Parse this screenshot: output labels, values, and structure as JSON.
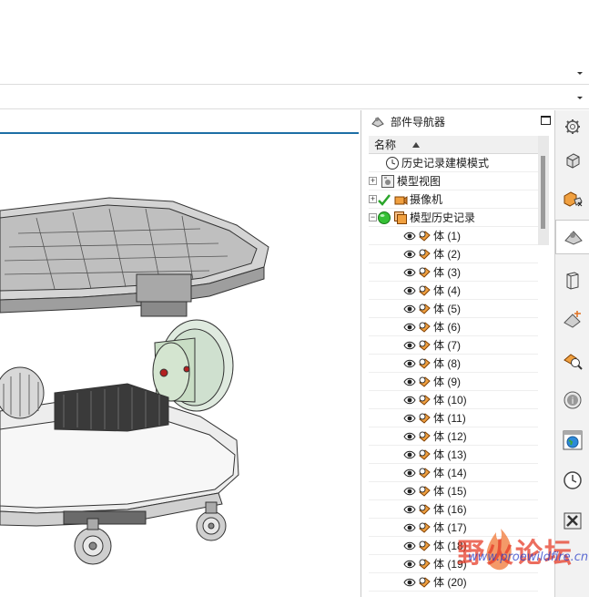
{
  "part_navigator": {
    "title": "部件导航器",
    "column_name": "名称",
    "items": [
      {
        "label": "历史记录建模模式",
        "type": "clock",
        "expand": ""
      },
      {
        "label": "模型视图",
        "type": "views",
        "expand": "+"
      },
      {
        "label": "摄像机",
        "type": "camera",
        "expand": "+"
      },
      {
        "label": "模型历史记录",
        "type": "history",
        "expand": "−"
      }
    ],
    "bodies": [
      "体 (1)",
      "体 (2)",
      "体 (3)",
      "体 (4)",
      "体 (5)",
      "体 (6)",
      "体 (7)",
      "体 (8)",
      "体 (9)",
      "体 (10)",
      "体 (11)",
      "体 (12)",
      "体 (13)",
      "体 (14)",
      "体 (15)",
      "体 (16)",
      "体 (17)",
      "体 (18)",
      "体 (19)",
      "体 (20)"
    ]
  },
  "sidebar": {
    "buttons": [
      "settings",
      "assembly-navigator",
      "constraint-navigator",
      "part-navigator",
      "reuse-library",
      "hd3d-tools",
      "visual-report",
      "web-browser",
      "history",
      "process-studio",
      "roles"
    ]
  },
  "watermark": {
    "text": "野火论坛",
    "url": "www.proewildfire.cn"
  }
}
